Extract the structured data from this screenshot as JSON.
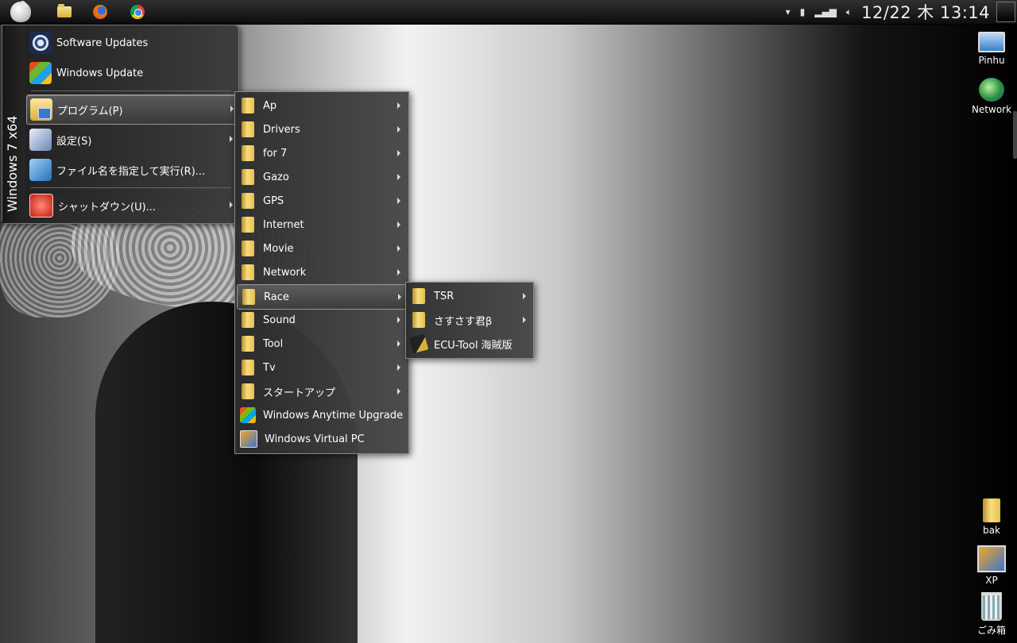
{
  "topbar": {
    "clock": "12/22 木 13:14"
  },
  "start_menu": {
    "vertical_label": "Windows 7 x64",
    "items": [
      {
        "label": "Software Updates"
      },
      {
        "label": "Windows Update"
      },
      {
        "label": "プログラム(P)",
        "submenu": true
      },
      {
        "label": "設定(S)",
        "submenu": true
      },
      {
        "label": "ファイル名を指定して実行(R)..."
      },
      {
        "label": "シャットダウン(U)...",
        "submenu": true
      }
    ]
  },
  "programs_menu": {
    "items": [
      {
        "label": "Ap"
      },
      {
        "label": "Drivers"
      },
      {
        "label": "for 7"
      },
      {
        "label": "Gazo"
      },
      {
        "label": "GPS"
      },
      {
        "label": "Internet"
      },
      {
        "label": "Movie"
      },
      {
        "label": "Network"
      },
      {
        "label": "Race"
      },
      {
        "label": "Sound"
      },
      {
        "label": "Tool"
      },
      {
        "label": "Tv"
      },
      {
        "label": "スタートアップ"
      },
      {
        "label": "Windows Anytime Upgrade"
      },
      {
        "label": "Windows Virtual PC"
      }
    ]
  },
  "race_menu": {
    "items": [
      {
        "label": "TSR"
      },
      {
        "label": "さすさす君β"
      },
      {
        "label": "ECU-Tool 海賊版"
      }
    ]
  },
  "desktop_icons": [
    {
      "label": "Pinhu"
    },
    {
      "label": "Network"
    },
    {
      "label": "bak"
    },
    {
      "label": "XP"
    },
    {
      "label": "ごみ箱"
    }
  ]
}
